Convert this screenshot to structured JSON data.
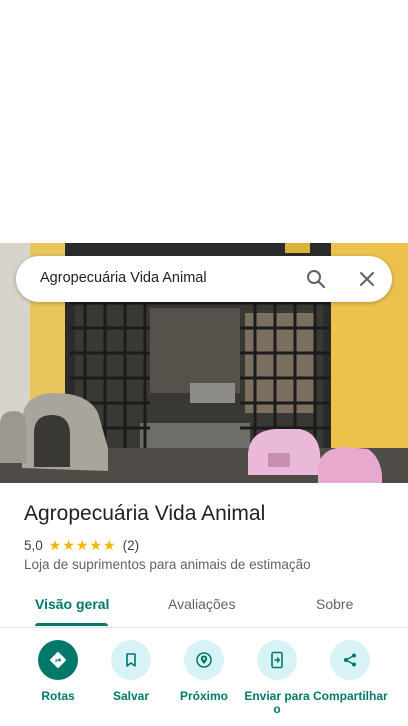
{
  "search": {
    "query": "Agropecuária Vida Animal"
  },
  "place": {
    "name": "Agropecuária Vida Animal",
    "rating": "5,0",
    "stars": 5,
    "review_count": "(2)",
    "category": "Loja de suprimentos para animais de estimação"
  },
  "tabs": [
    {
      "label": "Visão geral",
      "active": true
    },
    {
      "label": "Avaliações",
      "active": false
    },
    {
      "label": "Sobre",
      "active": false
    }
  ],
  "actions": [
    {
      "label": "Rotas",
      "icon": "directions-icon"
    },
    {
      "label": "Salvar",
      "icon": "bookmark-icon"
    },
    {
      "label": "Próximo",
      "icon": "nearby-icon"
    },
    {
      "label": "Enviar para o",
      "icon": "send-to-phone-icon"
    },
    {
      "label": "Compartilhar",
      "icon": "share-icon"
    }
  ],
  "colors": {
    "accent": "#00796b",
    "action_bg": "#d8f3f6",
    "star": "#f4b400"
  }
}
